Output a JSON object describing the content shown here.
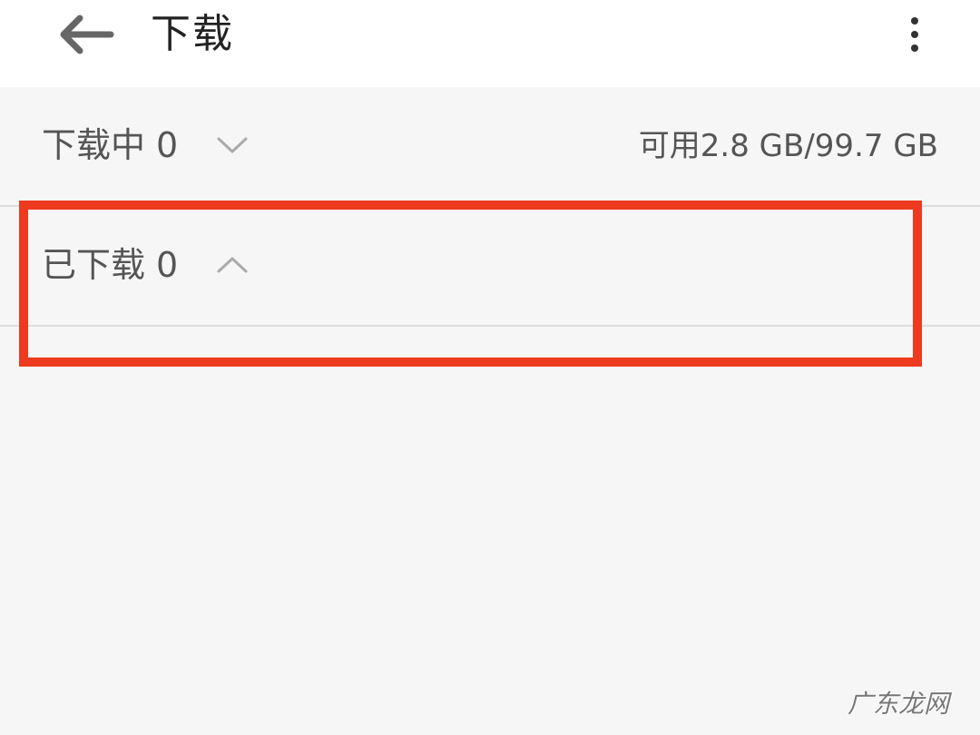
{
  "header": {
    "title": "下载",
    "back_icon": "arrow-left-icon",
    "more_icon": "more-vertical-icon"
  },
  "sections": {
    "downloading": {
      "label": "下载中",
      "count": "0",
      "chevron": "chevron-down-icon"
    },
    "downloaded": {
      "label": "已下载",
      "count": "0",
      "chevron": "chevron-up-icon"
    }
  },
  "storage": {
    "text": "可用2.8 GB/99.7 GB"
  },
  "watermark": {
    "text": "广东龙网"
  },
  "colors": {
    "highlight": "#ee3a1f",
    "background": "#f6f6f6",
    "header_bg": "#ffffff",
    "text_primary": "#222222",
    "text_secondary": "#555555"
  }
}
